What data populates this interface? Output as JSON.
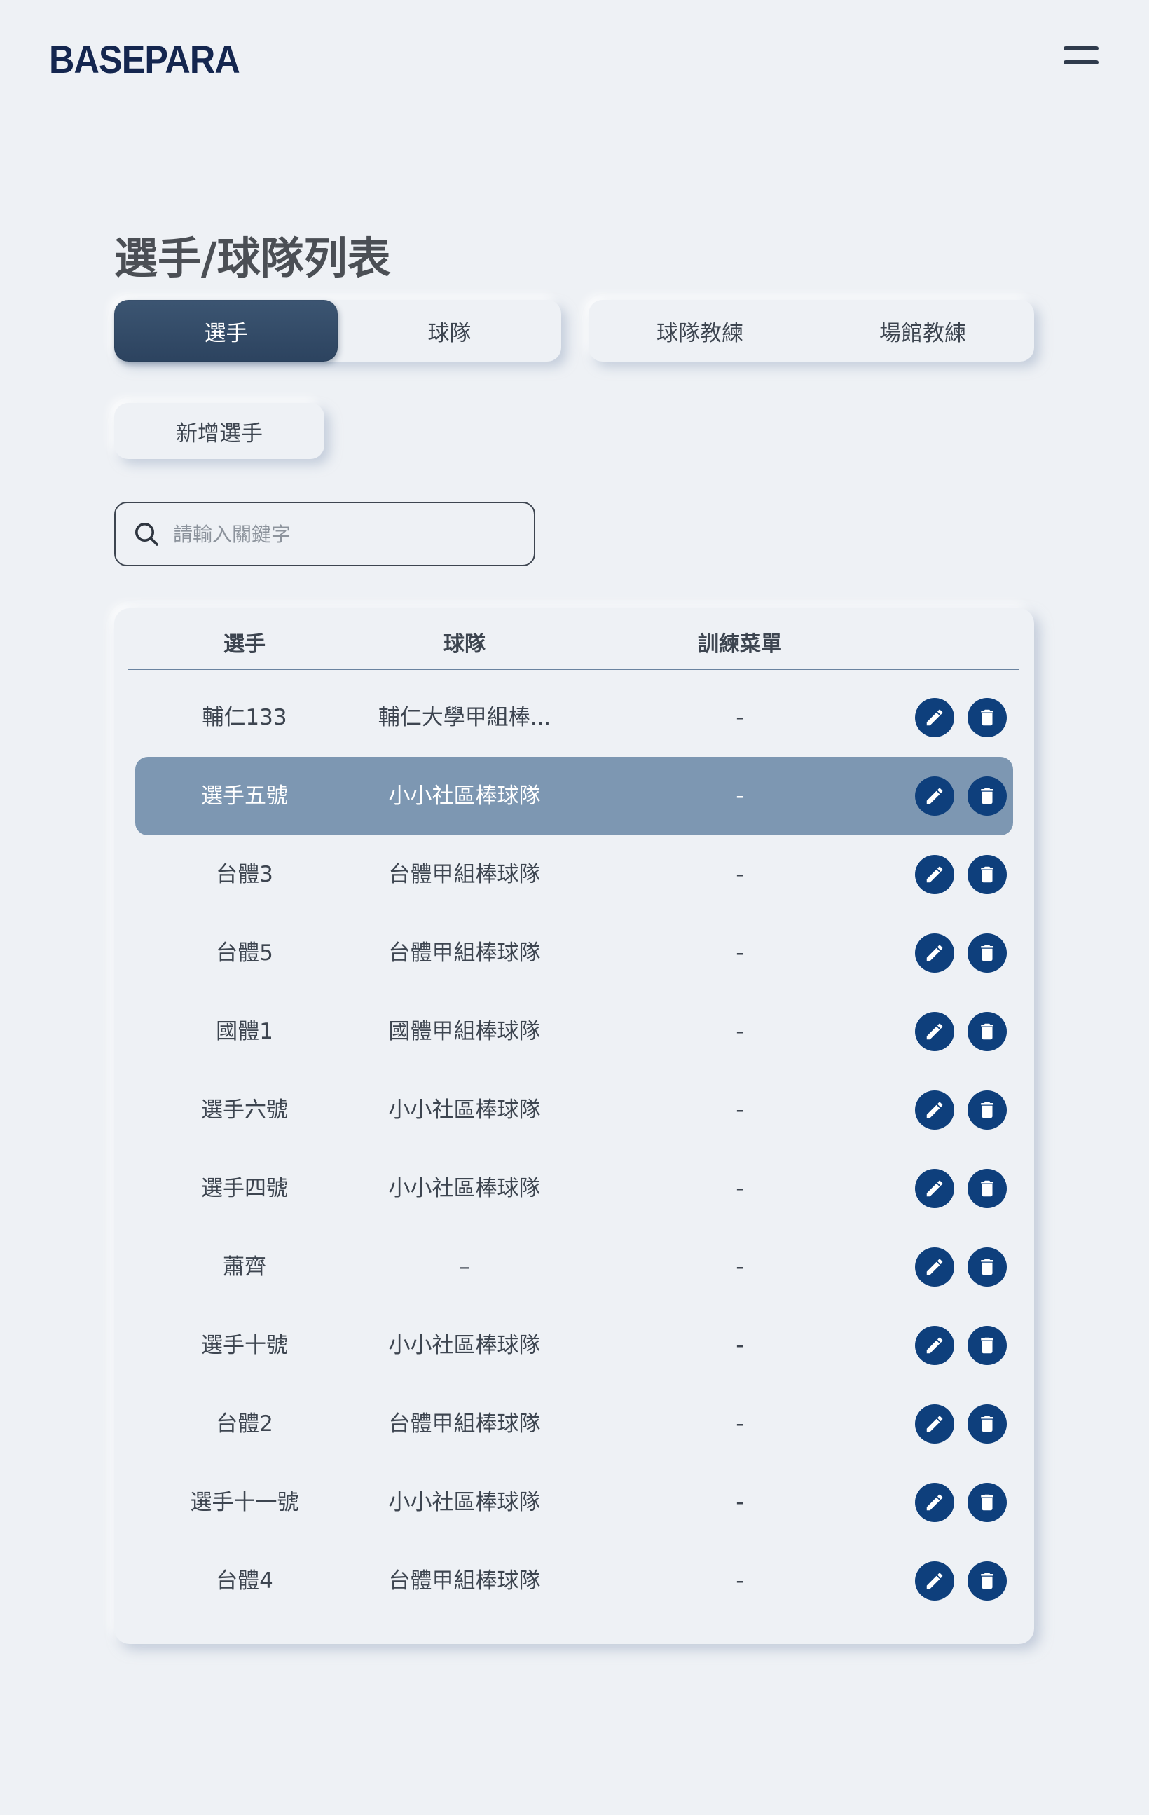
{
  "brand": {
    "logo_text": "BASEPARA"
  },
  "header": {
    "menu_icon": "hamburger-icon"
  },
  "page": {
    "title": "選手/球隊列表"
  },
  "tabs_primary": [
    {
      "label": "選手",
      "active": true
    },
    {
      "label": "球隊",
      "active": false
    }
  ],
  "tabs_secondary": [
    {
      "label": "球隊教練",
      "active": false
    },
    {
      "label": "場館教練",
      "active": false
    }
  ],
  "actions": {
    "add_label": "新增選手"
  },
  "search": {
    "placeholder": "請輸入關鍵字",
    "value": "",
    "icon": "search-icon"
  },
  "table": {
    "columns": [
      "選手",
      "球隊",
      "訓練菜單"
    ],
    "rows": [
      {
        "player": "輔仁133",
        "team": "輔仁大學甲組棒...",
        "menu": "-",
        "highlight": false
      },
      {
        "player": "選手五號",
        "team": "小小社區棒球隊",
        "menu": "-",
        "highlight": true
      },
      {
        "player": "台體3",
        "team": "台體甲組棒球隊",
        "menu": "-",
        "highlight": false
      },
      {
        "player": "台體5",
        "team": "台體甲組棒球隊",
        "menu": "-",
        "highlight": false
      },
      {
        "player": "國體1",
        "team": "國體甲組棒球隊",
        "menu": "-",
        "highlight": false
      },
      {
        "player": "選手六號",
        "team": "小小社區棒球隊",
        "menu": "-",
        "highlight": false
      },
      {
        "player": "選手四號",
        "team": "小小社區棒球隊",
        "menu": "-",
        "highlight": false
      },
      {
        "player": "蕭齊",
        "team": "–",
        "menu": "-",
        "highlight": false
      },
      {
        "player": "選手十號",
        "team": "小小社區棒球隊",
        "menu": "-",
        "highlight": false
      },
      {
        "player": "台體2",
        "team": "台體甲組棒球隊",
        "menu": "-",
        "highlight": false
      },
      {
        "player": "選手十一號",
        "team": "小小社區棒球隊",
        "menu": "-",
        "highlight": false
      },
      {
        "player": "台體4",
        "team": "台體甲組棒球隊",
        "menu": "-",
        "highlight": false
      }
    ],
    "row_actions": {
      "edit_icon": "pencil-icon",
      "delete_icon": "trash-icon"
    }
  },
  "colors": {
    "background": "#eef1f5",
    "tab_active": "#2c435f",
    "row_highlight": "#7d97b2",
    "icon_button": "#0e3f7c",
    "logo": "#14264f"
  }
}
